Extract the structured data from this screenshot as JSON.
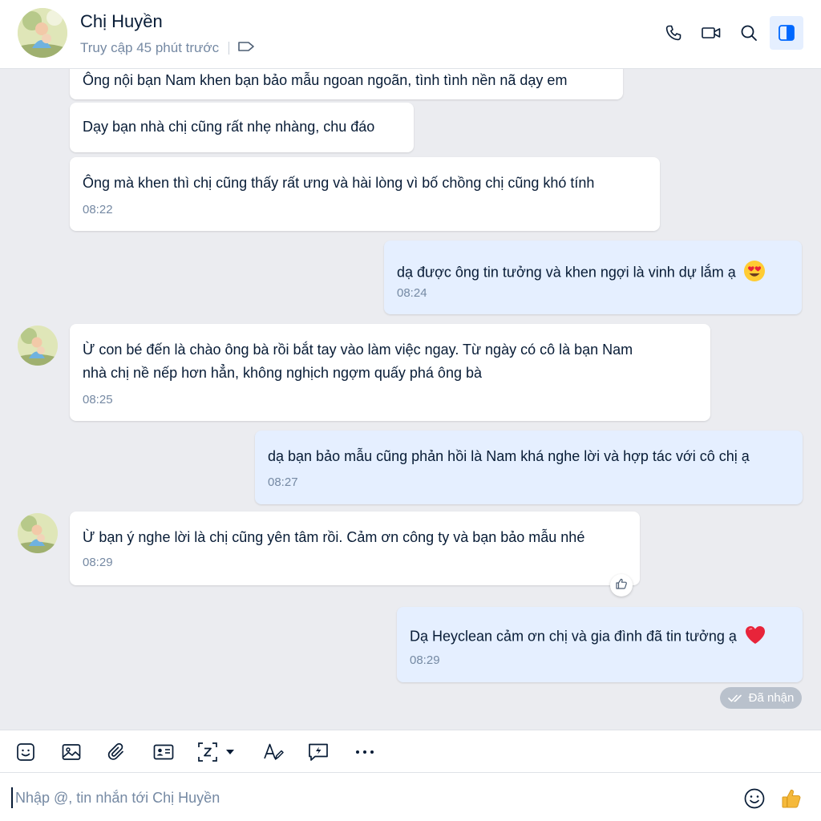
{
  "header": {
    "contact_name": "Chị Huyền",
    "last_seen": "Truy cập 45 phút trước",
    "icons": [
      "phone-icon",
      "video-call-icon",
      "search-icon",
      "sidebar-toggle-icon"
    ]
  },
  "messages": [
    {
      "direction": "in",
      "lines": [
        "Ông nội bạn Nam khen bạn bảo mẫu ngoan ngoãn, tình tình nền nã dạy em"
      ],
      "time": ""
    },
    {
      "direction": "in",
      "lines": [
        "Dạy bạn nhà chị cũng rất nhẹ nhàng, chu đáo"
      ],
      "time": ""
    },
    {
      "direction": "in",
      "lines": [
        "Ông mà khen thì chị cũng thấy rất ưng và hài lòng vì bố chồng chị cũng khó tính"
      ],
      "time": "08:22"
    },
    {
      "direction": "out",
      "lines": [
        "dạ được ông tin tưởng và khen ngợi là vinh dự lắm ạ"
      ],
      "emoji": "heart-eyes-emoji",
      "time": "08:24"
    },
    {
      "direction": "in",
      "lines": [
        "Ừ con bé đến là chào ông bà rồi bắt tay vào làm việc ngay. Từ ngày có cô là bạn Nam",
        "nhà chị nề nếp hơn hẳn, không nghịch ngợm quấy phá ông bà"
      ],
      "time": "08:25"
    },
    {
      "direction": "out",
      "lines": [
        "dạ bạn bảo mẫu cũng phản hồi là Nam khá nghe lời và hợp tác với cô chị ạ"
      ],
      "time": "08:27"
    },
    {
      "direction": "in",
      "lines": [
        "Ừ bạn ý nghe lời là chị cũng yên tâm rồi. Cảm ơn công ty và bạn bảo mẫu nhé"
      ],
      "time": "08:29"
    },
    {
      "direction": "out",
      "lines": [
        "Dạ Heyclean cảm ơn chị và gia đình đã tin tưởng ạ"
      ],
      "emoji": "red-heart-emoji",
      "time": "08:29"
    }
  ],
  "status": {
    "read_label": "Đã nhận"
  },
  "toolbar": {
    "icons": [
      "sticker-icon",
      "image-icon",
      "attachment-icon",
      "contact-card-icon",
      "screenshot-icon",
      "text-format-icon",
      "quick-message-icon",
      "more-icon"
    ]
  },
  "composer": {
    "placeholder": "Nhập @, tin nhắn tới Chị Huyền",
    "value": ""
  },
  "colors": {
    "outgoing_bubble": "#e5efff",
    "incoming_bubble": "#ffffff",
    "chat_background": "#ebecf0",
    "accent": "#0068ff"
  }
}
